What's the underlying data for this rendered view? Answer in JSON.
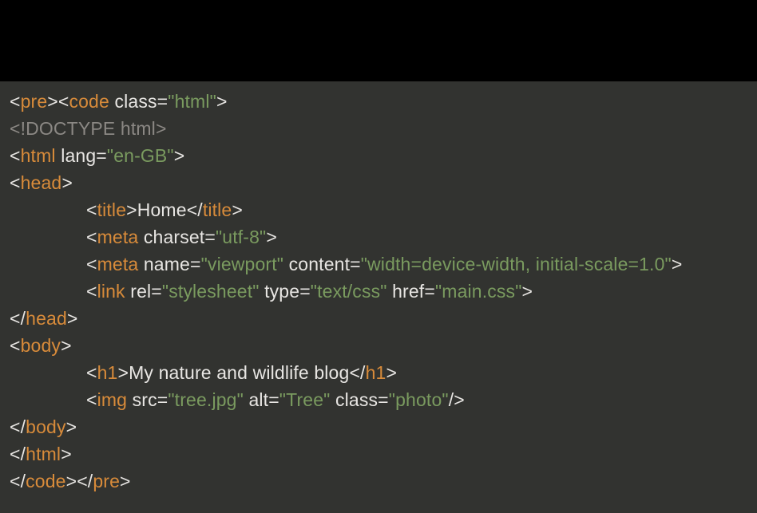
{
  "code": {
    "lines": [
      {
        "indent": 0,
        "tokens": [
          {
            "type": "punct",
            "text": "<"
          },
          {
            "type": "tag-name",
            "text": "pre"
          },
          {
            "type": "punct",
            "text": "><"
          },
          {
            "type": "tag-name",
            "text": "code"
          },
          {
            "type": "attr-name",
            "text": " class"
          },
          {
            "type": "punct",
            "text": "="
          },
          {
            "type": "attr-value",
            "text": "\"html\""
          },
          {
            "type": "punct",
            "text": ">"
          }
        ]
      },
      {
        "indent": 0,
        "tokens": [
          {
            "type": "doctype",
            "text": "<!DOCTYPE html>"
          }
        ]
      },
      {
        "indent": 0,
        "tokens": [
          {
            "type": "punct",
            "text": "<"
          },
          {
            "type": "tag-name",
            "text": "html"
          },
          {
            "type": "attr-name",
            "text": " lang"
          },
          {
            "type": "punct",
            "text": "="
          },
          {
            "type": "attr-value",
            "text": "\"en-GB\""
          },
          {
            "type": "punct",
            "text": ">"
          }
        ]
      },
      {
        "indent": 0,
        "tokens": [
          {
            "type": "punct",
            "text": "<"
          },
          {
            "type": "tag-name",
            "text": "head"
          },
          {
            "type": "punct",
            "text": ">"
          }
        ]
      },
      {
        "indent": 1,
        "tokens": [
          {
            "type": "punct",
            "text": "<"
          },
          {
            "type": "tag-name",
            "text": "title"
          },
          {
            "type": "punct",
            "text": ">"
          },
          {
            "type": "text",
            "text": "Home"
          },
          {
            "type": "punct",
            "text": "</"
          },
          {
            "type": "tag-name",
            "text": "title"
          },
          {
            "type": "punct",
            "text": ">"
          }
        ]
      },
      {
        "indent": 1,
        "tokens": [
          {
            "type": "punct",
            "text": "<"
          },
          {
            "type": "tag-name",
            "text": "meta"
          },
          {
            "type": "attr-name",
            "text": " charset"
          },
          {
            "type": "punct",
            "text": "="
          },
          {
            "type": "attr-value",
            "text": "\"utf-8\""
          },
          {
            "type": "punct",
            "text": ">"
          }
        ]
      },
      {
        "indent": 1,
        "tokens": [
          {
            "type": "punct",
            "text": "<"
          },
          {
            "type": "tag-name",
            "text": "meta"
          },
          {
            "type": "attr-name",
            "text": " name"
          },
          {
            "type": "punct",
            "text": "="
          },
          {
            "type": "attr-value",
            "text": "\"viewport\""
          },
          {
            "type": "attr-name",
            "text": " content"
          },
          {
            "type": "punct",
            "text": "="
          },
          {
            "type": "attr-value",
            "text": "\"width=device-width, initial-scale=1.0\""
          },
          {
            "type": "punct",
            "text": ">"
          }
        ]
      },
      {
        "indent": 1,
        "tokens": [
          {
            "type": "punct",
            "text": "<"
          },
          {
            "type": "tag-name",
            "text": "link"
          },
          {
            "type": "attr-name",
            "text": " rel"
          },
          {
            "type": "punct",
            "text": "="
          },
          {
            "type": "attr-value",
            "text": "\"stylesheet\""
          },
          {
            "type": "attr-name",
            "text": " type"
          },
          {
            "type": "punct",
            "text": "="
          },
          {
            "type": "attr-value",
            "text": "\"text/css\""
          },
          {
            "type": "attr-name",
            "text": " href"
          },
          {
            "type": "punct",
            "text": "="
          },
          {
            "type": "attr-value",
            "text": "\"main.css\""
          },
          {
            "type": "punct",
            "text": ">"
          }
        ]
      },
      {
        "indent": 0,
        "tokens": [
          {
            "type": "punct",
            "text": "</"
          },
          {
            "type": "tag-name",
            "text": "head"
          },
          {
            "type": "punct",
            "text": ">"
          }
        ]
      },
      {
        "indent": 0,
        "tokens": [
          {
            "type": "punct",
            "text": "<"
          },
          {
            "type": "tag-name",
            "text": "body"
          },
          {
            "type": "punct",
            "text": ">"
          }
        ]
      },
      {
        "indent": 1,
        "tokens": [
          {
            "type": "punct",
            "text": "<"
          },
          {
            "type": "tag-name",
            "text": "h1"
          },
          {
            "type": "punct",
            "text": ">"
          },
          {
            "type": "text",
            "text": "My nature and wildlife blog"
          },
          {
            "type": "punct",
            "text": "</"
          },
          {
            "type": "tag-name",
            "text": "h1"
          },
          {
            "type": "punct",
            "text": ">"
          }
        ]
      },
      {
        "indent": 1,
        "tokens": [
          {
            "type": "punct",
            "text": "<"
          },
          {
            "type": "tag-name",
            "text": "img"
          },
          {
            "type": "attr-name",
            "text": " src"
          },
          {
            "type": "punct",
            "text": "="
          },
          {
            "type": "attr-value",
            "text": "\"tree.jpg\""
          },
          {
            "type": "attr-name",
            "text": " alt"
          },
          {
            "type": "punct",
            "text": "="
          },
          {
            "type": "attr-value",
            "text": "\"Tree\""
          },
          {
            "type": "attr-name",
            "text": " class"
          },
          {
            "type": "punct",
            "text": "="
          },
          {
            "type": "attr-value",
            "text": "\"photo\""
          },
          {
            "type": "punct",
            "text": "/>"
          }
        ]
      },
      {
        "indent": 0,
        "tokens": [
          {
            "type": "punct",
            "text": "</"
          },
          {
            "type": "tag-name",
            "text": "body"
          },
          {
            "type": "punct",
            "text": ">"
          }
        ]
      },
      {
        "indent": 0,
        "tokens": [
          {
            "type": "punct",
            "text": "</"
          },
          {
            "type": "tag-name",
            "text": "html"
          },
          {
            "type": "punct",
            "text": ">"
          }
        ]
      },
      {
        "indent": 0,
        "tokens": [
          {
            "type": "punct",
            "text": "</"
          },
          {
            "type": "tag-name",
            "text": "code"
          },
          {
            "type": "punct",
            "text": "></"
          },
          {
            "type": "tag-name",
            "text": "pre"
          },
          {
            "type": "punct",
            "text": ">"
          }
        ]
      }
    ]
  }
}
